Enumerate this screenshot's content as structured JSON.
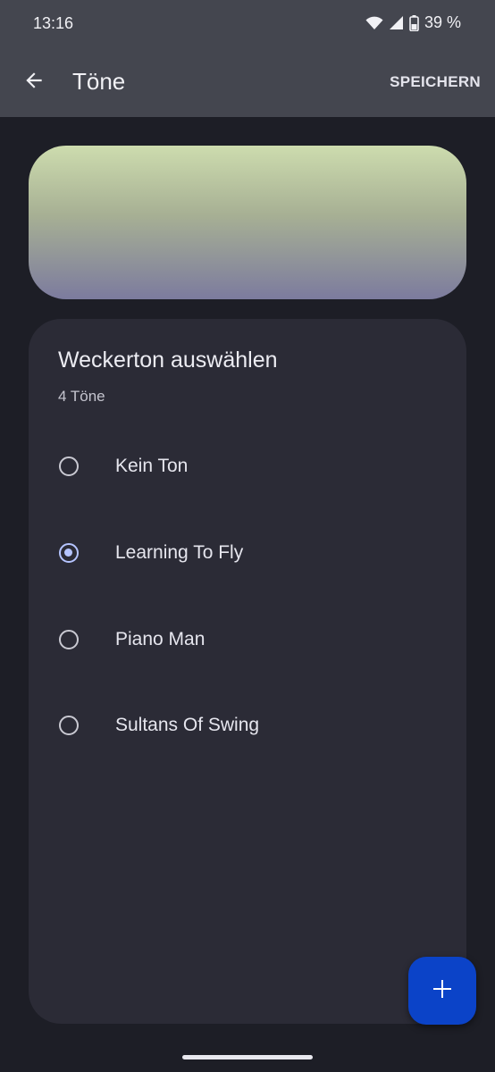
{
  "status_bar": {
    "time": "13:16",
    "battery_text": "39 %",
    "icons": [
      "wifi-icon",
      "signal-icon",
      "battery-icon"
    ]
  },
  "app_bar": {
    "title": "Töne",
    "save_label": "SPEICHERN",
    "back_icon": "arrow-left-icon"
  },
  "card": {
    "title": "Weckerton auswählen",
    "subtitle": "4 Töne",
    "options": [
      {
        "label": "Kein Ton",
        "selected": false
      },
      {
        "label": "Learning To Fly",
        "selected": true
      },
      {
        "label": "Piano Man",
        "selected": false
      },
      {
        "label": "Sultans Of Swing",
        "selected": false
      }
    ]
  },
  "fab": {
    "icon": "plus-icon"
  },
  "colors": {
    "accent": "#b5c4ff",
    "fab": "#0b43c8",
    "app_bar": "#44464f",
    "background": "#1d1e26",
    "card": "#2b2b36"
  }
}
